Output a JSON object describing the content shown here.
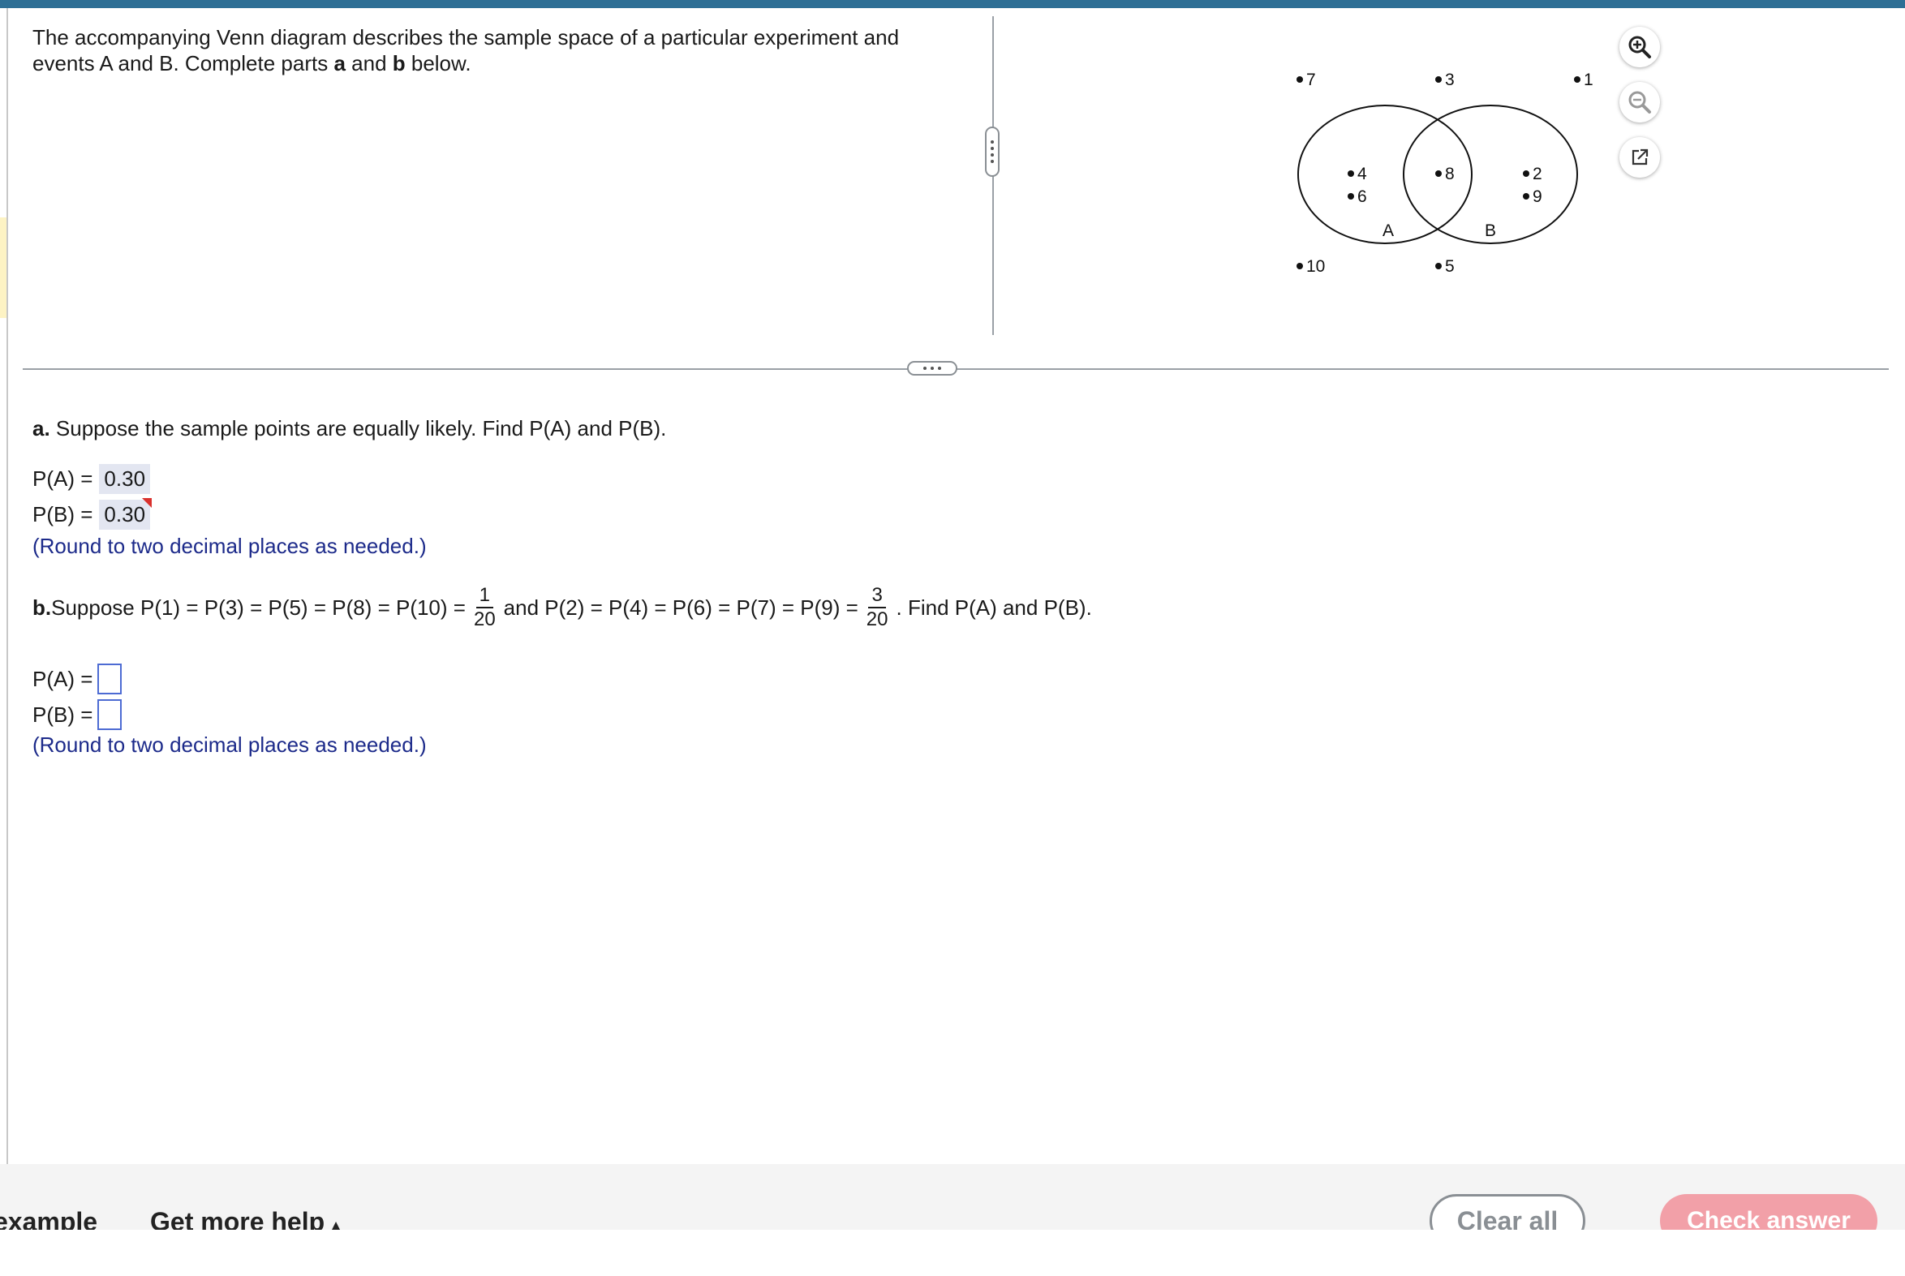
{
  "intro": {
    "line1": "The accompanying Venn diagram describes the sample space of a particular experiment and",
    "line2_pre": "events A and B. Complete parts ",
    "line2_a": "a",
    "line2_mid": " and ",
    "line2_b": "b",
    "line2_post": " below."
  },
  "venn": {
    "label_a": "A",
    "label_b": "B",
    "points": {
      "p7": "7",
      "p3": "3",
      "p1": "1",
      "p4": "4",
      "p6": "6",
      "p8": "8",
      "p2": "2",
      "p9": "9",
      "p10": "10",
      "p5": "5"
    }
  },
  "tools": {
    "zoom_in": "zoom-in-icon",
    "zoom_out": "zoom-out-icon",
    "popout": "external-link-icon"
  },
  "part_a": {
    "label": "a.",
    "text": " Suppose the sample points are equally likely. Find P(A) and P(B).",
    "pa_label": "P(A) =",
    "pa_value": "0.30",
    "pb_label": "P(B) =",
    "pb_value": "0.30",
    "hint": "(Round to two decimal places as needed.)"
  },
  "part_b": {
    "label": "b.",
    "text1": " Suppose P(1) = P(3) = P(5) = P(8) = P(10) =",
    "frac1_num": "1",
    "frac1_den": "20",
    "text2": "and P(2) = P(4) = P(6) = P(7) = P(9) =",
    "frac2_num": "3",
    "frac2_den": "20",
    "text3": ". Find P(A) and P(B).",
    "pa_label": "P(A) =",
    "pb_label": "P(B) =",
    "hint": "(Round to two decimal places as needed.)"
  },
  "footer": {
    "example": "example",
    "more_help": "Get more help",
    "more_help_arrow": "▴",
    "clear_all": "Clear all",
    "check_answer": "Check answer"
  }
}
